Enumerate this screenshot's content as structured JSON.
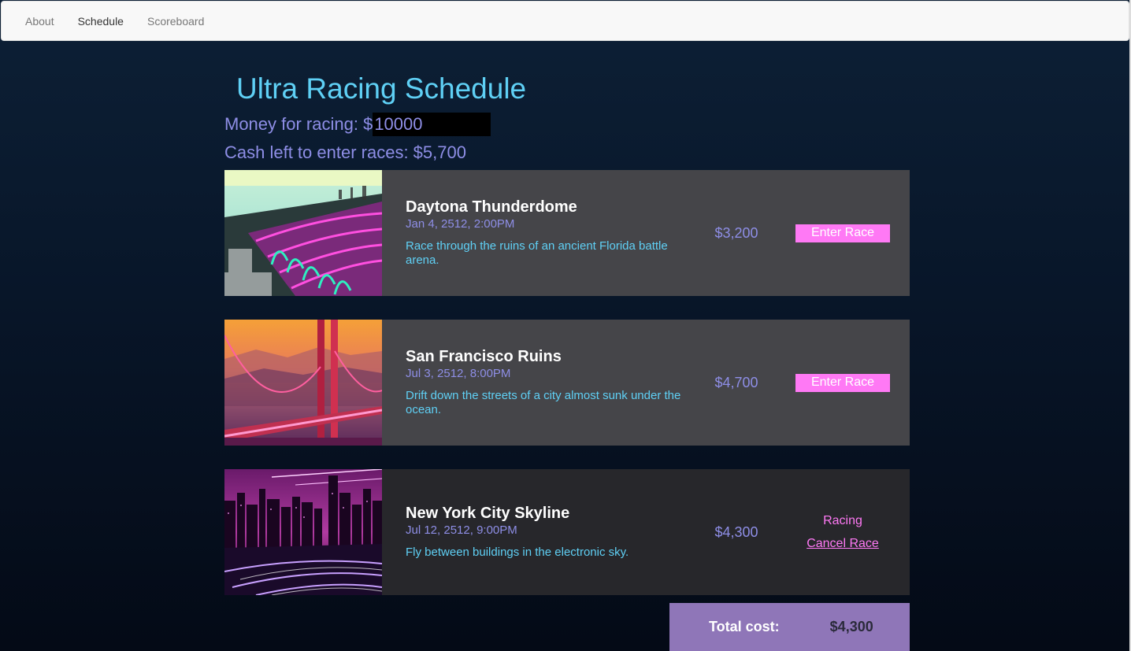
{
  "nav": {
    "items": [
      {
        "label": "About"
      },
      {
        "label": "Schedule"
      },
      {
        "label": "Scoreboard"
      }
    ]
  },
  "page": {
    "title": "Ultra Racing Schedule",
    "money_label": "Money for racing: $",
    "money_value": "10000",
    "cash_left": "Cash left to enter races: $5,700"
  },
  "races": [
    {
      "name": "Daytona Thunderdome",
      "date": "Jan 4, 2512, 2:00PM",
      "description": "Race through the ruins of an ancient Florida battle arena.",
      "price": "$3,200",
      "action": "Enter Race"
    },
    {
      "name": "San Francisco Ruins",
      "date": "Jul 3, 2512, 8:00PM",
      "description": "Drift down the streets of a city almost sunk under the ocean.",
      "price": "$4,700",
      "action": "Enter Race"
    },
    {
      "name": "New York City Skyline",
      "date": "Jul 12, 2512, 9:00PM",
      "description": "Fly between buildings in the electronic sky.",
      "price": "$4,300",
      "status": "Racing",
      "cancel": "Cancel Race"
    }
  ],
  "total": {
    "label": "Total cost:",
    "value": "$4,300"
  },
  "colors": {
    "title": "#5fd0f5",
    "lavender": "#8e8ee6",
    "pink": "#ff79f5",
    "card": "#454549",
    "card_selected": "#27272b",
    "total_bg": "#8f76b8"
  }
}
